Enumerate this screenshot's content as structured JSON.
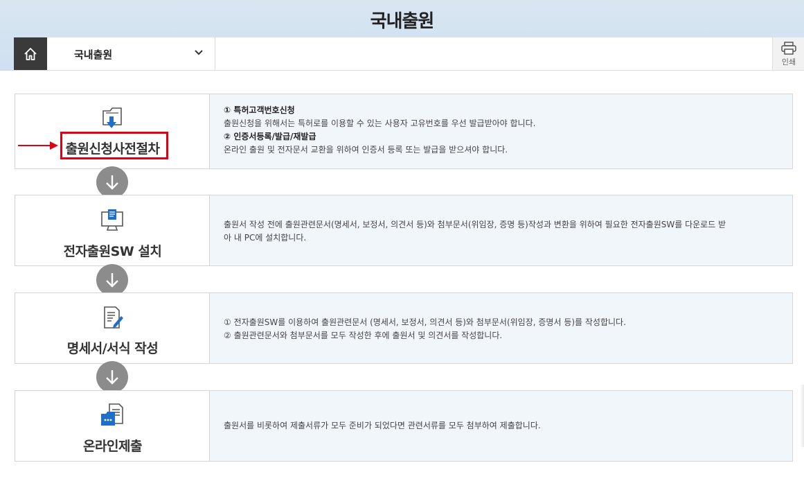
{
  "page": {
    "title": "국내출원"
  },
  "nav": {
    "home_icon": "home-icon",
    "selected": "국내출원",
    "print_label": "인쇄"
  },
  "steps": [
    {
      "title": "출원신청사전절차",
      "icon": "folder-download-icon",
      "highlighted": true,
      "lines": [
        {
          "text": "① 특허고객번호신청",
          "bold": true
        },
        {
          "text": "출원신청을 위해서는 특허로를 이용할 수 있는 사용자 고유번호를 우선 발급받아야 합니다.",
          "bold": false
        },
        {
          "text": "② 인증서등록/발급/재발급",
          "bold": true
        },
        {
          "text": "온라인 출원 및 전자문서 교환을 위하여 인증서 등록 또는 발급을 받으셔야 합니다.",
          "bold": false
        }
      ]
    },
    {
      "title": "전자출원SW 설치",
      "icon": "computer-install-icon",
      "highlighted": false,
      "lines": [
        {
          "text": "출원서 작성 전에 출원관련문서(명세서, 보정서, 의견서 등)와 첨부문서(위임장, 증명 등)작성과 변환을 위하여 필요한 전자출원SW를 다운로드 받",
          "bold": false
        },
        {
          "text": "아 내 PC에 설치합니다.",
          "bold": false
        }
      ]
    },
    {
      "title": "명세서/서식 작성",
      "icon": "document-edit-icon",
      "highlighted": false,
      "lines": [
        {
          "text": "① 전자출원SW를 이용하여 출원관련문서 (명세서, 보정서, 의견서 등)와 첨부문서(위임장, 증명서 등)를 작성합니다.",
          "bold": false
        },
        {
          "text": "② 출원관련문서와 첨부문서를 모두 작성한 후에 출원서 및 의견서를 작성합니다.",
          "bold": false
        }
      ]
    },
    {
      "title": "온라인제출",
      "icon": "online-submit-icon",
      "highlighted": false,
      "lines": [
        {
          "text": "출원서를 비롯하여 제출서류가 모두 준비가 되었다면 관련서류를 모두 첨부하여 제출합니다.",
          "bold": false
        }
      ]
    }
  ],
  "colors": {
    "banner": "#d9e6f2",
    "highlight": "#e00012",
    "step_bg": "#f1f6fb",
    "connector": "#8c8c8c"
  }
}
